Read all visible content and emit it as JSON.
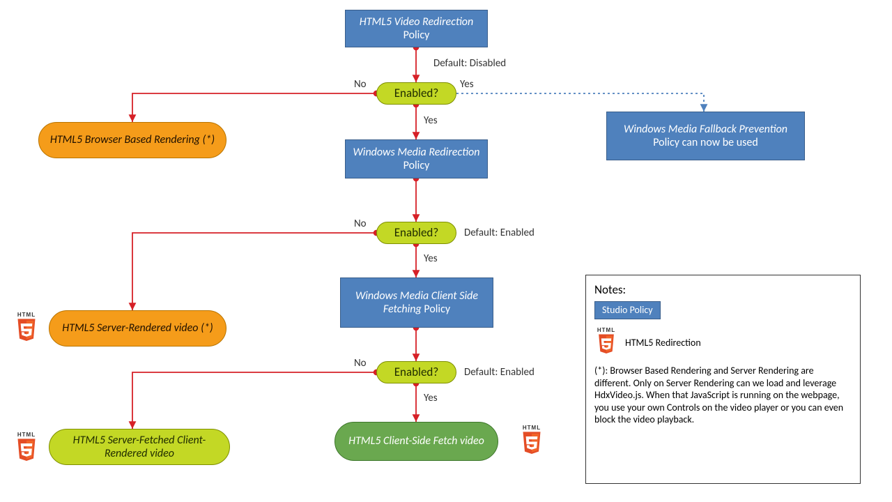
{
  "nodes": {
    "policy1": {
      "title_em": "HTML5 Video Redirection",
      "title_rest": " Policy"
    },
    "policy2": {
      "title_em": "Windows Media Redirection",
      "title_rest": " Policy"
    },
    "policy3": {
      "title_em": "Windows Media Client Side Fetching",
      "title_rest": " Policy"
    },
    "fallback": {
      "title_em": "Windows Media Fallback Prevention",
      "title_rest": " Policy can now be used"
    },
    "dec1": "Enabled?",
    "dec2": "Enabled?",
    "dec3": "Enabled?",
    "out_orange1": "HTML5 Browser Based Rendering (*)",
    "out_orange2": "HTML5 Server-Rendered video (*)",
    "out_lime": "HTML5 Server-Fetched Client-Rendered video",
    "out_green": "HTML5 Client-Side Fetch video"
  },
  "labels": {
    "default_disabled": "Default: Disabled",
    "default_enabled": "Default: Enabled",
    "no": "No",
    "yes": "Yes"
  },
  "notes": {
    "heading": "Notes:",
    "legend_policy": "Studio Policy",
    "legend_html5": "HTML5 Redirection",
    "footnote": "(*): Browser Based Rendering and Server Rendering are different. Only on Server Rendering can we load and leverage HdxVideo.js. When that JavaScript is running on the webpage, you use your own Controls on the video player or you can even block the video playback."
  },
  "icon_label": "HTML"
}
